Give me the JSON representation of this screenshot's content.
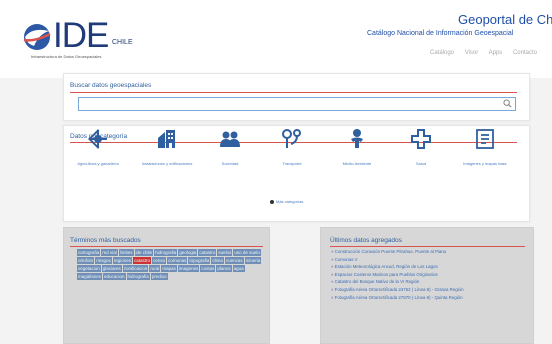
{
  "colors": {
    "brand_blue": "#1f3b7a",
    "link_blue": "#2f5f9e",
    "accent_red": "#d9534f",
    "tag_blue": "#6f8fb6",
    "tag_active": "#cc3333"
  },
  "header": {
    "logo_text": "IDE",
    "logo_chile": "CHILE",
    "logo_sub": "Infraestructura de Datos Geoespaciales",
    "title": "Geoportal de Chile",
    "subtitle": "Catálogo Nacional de Información Geoespacial",
    "nav": [
      "Catálogo",
      "Visor",
      "Apps",
      "Contacto"
    ]
  },
  "search": {
    "title": "Buscar datos geoespaciales",
    "placeholder": "",
    "value": ""
  },
  "categories": {
    "title": "Datos por categoría",
    "items": [
      {
        "label": "Agricultura y ganadería",
        "icon": "plant-icon"
      },
      {
        "label": "Instalaciones y edificaciones",
        "icon": "building-icon"
      },
      {
        "label": "Sociedad",
        "icon": "people-icon"
      },
      {
        "label": "Transporte",
        "icon": "route-icon"
      },
      {
        "label": "Medio Ambiente",
        "icon": "environment-icon"
      },
      {
        "label": "Salud",
        "icon": "health-cross-icon"
      },
      {
        "label": "Imágenes y mapas base",
        "icon": "map-icon"
      }
    ],
    "more": "Más categorías"
  },
  "terms": {
    "title": "Términos más buscados",
    "tags": [
      "cartografia",
      "red vial",
      "limites",
      "ide chile",
      "hidrografia",
      "geologia",
      "catastro",
      "suelos",
      "uso de suelo",
      "ortofoto",
      "riesgos",
      "regiones",
      "catastro",
      "censo",
      "comunas",
      "topografia",
      "clima",
      "cuencas",
      "mineria",
      "vegetacion",
      "glaciares",
      "zonificacion",
      "rural",
      "mapas",
      "imagenes",
      "costas",
      "planos",
      "agua",
      "magallanes",
      "educacion",
      "hidrografia",
      "predios"
    ],
    "active_index": 12
  },
  "latest": {
    "title": "Últimos datos agregados",
    "items": [
      "Construcción Conexión Puente Pitrahue, Puente al Piano",
      "Comunas V",
      "Estación Meteorológica Ancud, Región de Los Lagos",
      "Espacios Costeros Marinos para Pueblos Originarios",
      "Catastro del Bosque Nativo de la VI Región",
      "Fotografía Aérea Ortorectificada 24762 ( Línea 8) - Octava Región",
      "Fotografía Aérea Ortorectificada 27870 ( Línea 8) - Quinta Región"
    ]
  }
}
